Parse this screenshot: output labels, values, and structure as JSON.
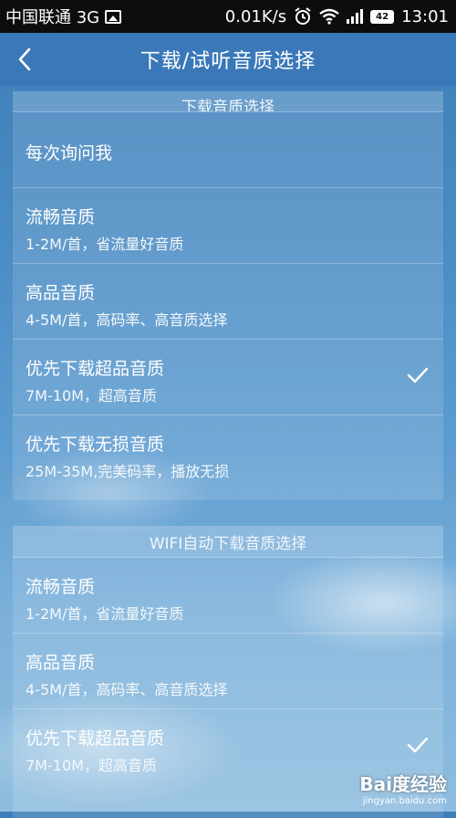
{
  "status_bar": {
    "carrier": "中国联通 3G",
    "speed": "0.01K/s",
    "battery": "42",
    "time": "13:01"
  },
  "header": {
    "title": "下载/试听音质选择"
  },
  "download_section": {
    "title": "下载音质选择",
    "items": [
      {
        "title": "每次询问我",
        "subtitle": "",
        "selected": false
      },
      {
        "title": "流畅音质",
        "subtitle": "1-2M/首，省流量好音质",
        "selected": false
      },
      {
        "title": "高品音质",
        "subtitle": "4-5M/首，高码率、高音质选择",
        "selected": false
      },
      {
        "title": "优先下载超品音质",
        "subtitle": "7M-10M，超高音质",
        "selected": true
      },
      {
        "title": "优先下载无损音质",
        "subtitle": "25M-35M,完美码率，播放无损",
        "selected": false
      }
    ]
  },
  "wifi_section": {
    "title": "WIFI自动下载音质选择",
    "items": [
      {
        "title": "流畅音质",
        "subtitle": "1-2M/首，省流量好音质",
        "selected": false
      },
      {
        "title": "高品音质",
        "subtitle": "4-5M/首，高码率、高音质选择",
        "selected": false
      },
      {
        "title": "优先下载超品音质",
        "subtitle": "7M-10M，超高音质",
        "selected": true
      }
    ]
  },
  "watermark": {
    "logo": "Bai度经验",
    "url": "jingyan.baidu.com"
  },
  "icons": {
    "back": "chevron-left-icon",
    "check": "checkmark-icon"
  }
}
